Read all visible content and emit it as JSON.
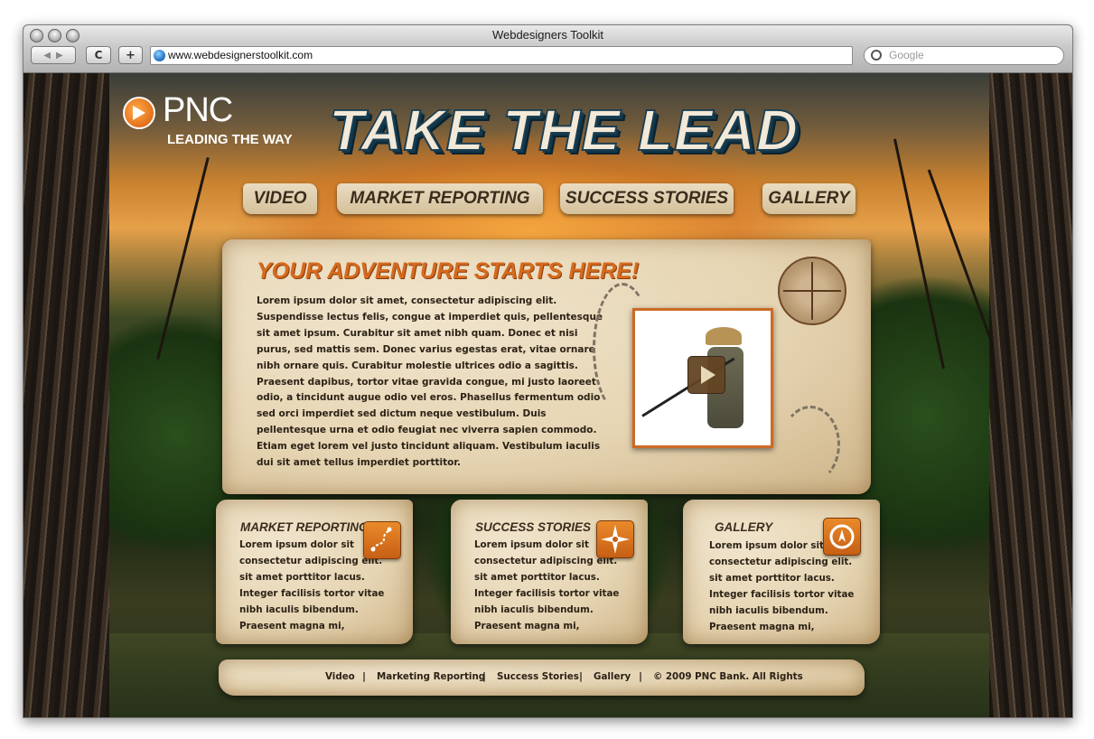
{
  "browser": {
    "window_title": "Webdesigners Toolkit",
    "back_label": "◀",
    "forward_label": "▶",
    "reload_label": "C",
    "add_label": "+",
    "url": "www.webdesignerstoolkit.com",
    "search_placeholder": "Google"
  },
  "site": {
    "logo_text": "PNC",
    "logo_tagline": "LEADING THE WAY",
    "hero_title": "TAKE THE LEAD",
    "nav": [
      "VIDEO",
      "MARKET REPORTING",
      "SUCCESS STORIES",
      "GALLERY"
    ],
    "main": {
      "heading": "YOUR ADVENTURE STARTS HERE!",
      "body": "Lorem ipsum dolor sit amet, consectetur adipiscing elit. Suspendisse lectus felis, congue at imperdiet quis, pellentesque sit amet ipsum. Curabitur sit amet nibh quam. Donec et nisi purus, sed mattis sem. Donec varius egestas erat, vitae ornare nibh ornare quis. Curabitur molestie ultrices odio a sagittis. Praesent dapibus, tortor vitae gravida congue, mi justo laoreet odio, a tincidunt augue odio vel eros. Phasellus fermentum odio sed orci imperdiet sed dictum neque vestibulum. Duis pellentesque urna et odio feugiat nec viverra sapien commodo. Etiam eget lorem vel justo tincidunt aliquam. Vestibulum iaculis dui sit amet tellus imperdiet porttitor."
    },
    "cards": [
      {
        "title": "MARKET REPORTING",
        "text": "Lorem ipsum dolor sit consectetur adipiscing elit. sit amet porttitor lacus. Integer facilisis tortor vitae nibh iaculis bibendum. Praesent magna mi,",
        "icon": "map-route-icon"
      },
      {
        "title": "SUCCESS STORIES",
        "text": "Lorem ipsum dolor sit consectetur adipiscing elit. sit amet porttitor lacus. Integer facilisis tortor vitae nibh iaculis bibendum. Praesent magna mi,",
        "icon": "compass-star-icon"
      },
      {
        "title": "GALLERY",
        "text": "Lorem ipsum dolor sit consectetur adipiscing elit. sit amet porttitor lacus. Integer facilisis tortor vitae nibh iaculis bibendum. Praesent magna mi,",
        "icon": "compass-icon"
      }
    ],
    "footer": {
      "links": [
        "Video",
        "Marketing Reporting",
        "Success Stories",
        "Gallery"
      ],
      "separator": "|",
      "copyright": "© 2009 PNC Bank. All Rights"
    },
    "colors": {
      "accent_orange": "#d66a1e",
      "parchment": "#e6d5b3",
      "title_blue": "#1a3f52",
      "text_dark": "#2c2216"
    }
  }
}
